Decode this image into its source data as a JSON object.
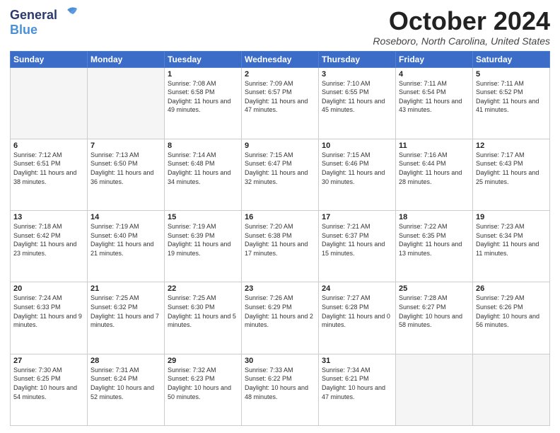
{
  "header": {
    "logo_line1": "General",
    "logo_line2": "Blue",
    "month_title": "October 2024",
    "location": "Roseboro, North Carolina, United States"
  },
  "days_of_week": [
    "Sunday",
    "Monday",
    "Tuesday",
    "Wednesday",
    "Thursday",
    "Friday",
    "Saturday"
  ],
  "weeks": [
    [
      {
        "day": "",
        "sunrise": "",
        "sunset": "",
        "daylight": "",
        "empty": true
      },
      {
        "day": "",
        "sunrise": "",
        "sunset": "",
        "daylight": "",
        "empty": true
      },
      {
        "day": "1",
        "sunrise": "Sunrise: 7:08 AM",
        "sunset": "Sunset: 6:58 PM",
        "daylight": "Daylight: 11 hours and 49 minutes.",
        "empty": false
      },
      {
        "day": "2",
        "sunrise": "Sunrise: 7:09 AM",
        "sunset": "Sunset: 6:57 PM",
        "daylight": "Daylight: 11 hours and 47 minutes.",
        "empty": false
      },
      {
        "day": "3",
        "sunrise": "Sunrise: 7:10 AM",
        "sunset": "Sunset: 6:55 PM",
        "daylight": "Daylight: 11 hours and 45 minutes.",
        "empty": false
      },
      {
        "day": "4",
        "sunrise": "Sunrise: 7:11 AM",
        "sunset": "Sunset: 6:54 PM",
        "daylight": "Daylight: 11 hours and 43 minutes.",
        "empty": false
      },
      {
        "day": "5",
        "sunrise": "Sunrise: 7:11 AM",
        "sunset": "Sunset: 6:52 PM",
        "daylight": "Daylight: 11 hours and 41 minutes.",
        "empty": false
      }
    ],
    [
      {
        "day": "6",
        "sunrise": "Sunrise: 7:12 AM",
        "sunset": "Sunset: 6:51 PM",
        "daylight": "Daylight: 11 hours and 38 minutes.",
        "empty": false
      },
      {
        "day": "7",
        "sunrise": "Sunrise: 7:13 AM",
        "sunset": "Sunset: 6:50 PM",
        "daylight": "Daylight: 11 hours and 36 minutes.",
        "empty": false
      },
      {
        "day": "8",
        "sunrise": "Sunrise: 7:14 AM",
        "sunset": "Sunset: 6:48 PM",
        "daylight": "Daylight: 11 hours and 34 minutes.",
        "empty": false
      },
      {
        "day": "9",
        "sunrise": "Sunrise: 7:15 AM",
        "sunset": "Sunset: 6:47 PM",
        "daylight": "Daylight: 11 hours and 32 minutes.",
        "empty": false
      },
      {
        "day": "10",
        "sunrise": "Sunrise: 7:15 AM",
        "sunset": "Sunset: 6:46 PM",
        "daylight": "Daylight: 11 hours and 30 minutes.",
        "empty": false
      },
      {
        "day": "11",
        "sunrise": "Sunrise: 7:16 AM",
        "sunset": "Sunset: 6:44 PM",
        "daylight": "Daylight: 11 hours and 28 minutes.",
        "empty": false
      },
      {
        "day": "12",
        "sunrise": "Sunrise: 7:17 AM",
        "sunset": "Sunset: 6:43 PM",
        "daylight": "Daylight: 11 hours and 25 minutes.",
        "empty": false
      }
    ],
    [
      {
        "day": "13",
        "sunrise": "Sunrise: 7:18 AM",
        "sunset": "Sunset: 6:42 PM",
        "daylight": "Daylight: 11 hours and 23 minutes.",
        "empty": false
      },
      {
        "day": "14",
        "sunrise": "Sunrise: 7:19 AM",
        "sunset": "Sunset: 6:40 PM",
        "daylight": "Daylight: 11 hours and 21 minutes.",
        "empty": false
      },
      {
        "day": "15",
        "sunrise": "Sunrise: 7:19 AM",
        "sunset": "Sunset: 6:39 PM",
        "daylight": "Daylight: 11 hours and 19 minutes.",
        "empty": false
      },
      {
        "day": "16",
        "sunrise": "Sunrise: 7:20 AM",
        "sunset": "Sunset: 6:38 PM",
        "daylight": "Daylight: 11 hours and 17 minutes.",
        "empty": false
      },
      {
        "day": "17",
        "sunrise": "Sunrise: 7:21 AM",
        "sunset": "Sunset: 6:37 PM",
        "daylight": "Daylight: 11 hours and 15 minutes.",
        "empty": false
      },
      {
        "day": "18",
        "sunrise": "Sunrise: 7:22 AM",
        "sunset": "Sunset: 6:35 PM",
        "daylight": "Daylight: 11 hours and 13 minutes.",
        "empty": false
      },
      {
        "day": "19",
        "sunrise": "Sunrise: 7:23 AM",
        "sunset": "Sunset: 6:34 PM",
        "daylight": "Daylight: 11 hours and 11 minutes.",
        "empty": false
      }
    ],
    [
      {
        "day": "20",
        "sunrise": "Sunrise: 7:24 AM",
        "sunset": "Sunset: 6:33 PM",
        "daylight": "Daylight: 11 hours and 9 minutes.",
        "empty": false
      },
      {
        "day": "21",
        "sunrise": "Sunrise: 7:25 AM",
        "sunset": "Sunset: 6:32 PM",
        "daylight": "Daylight: 11 hours and 7 minutes.",
        "empty": false
      },
      {
        "day": "22",
        "sunrise": "Sunrise: 7:25 AM",
        "sunset": "Sunset: 6:30 PM",
        "daylight": "Daylight: 11 hours and 5 minutes.",
        "empty": false
      },
      {
        "day": "23",
        "sunrise": "Sunrise: 7:26 AM",
        "sunset": "Sunset: 6:29 PM",
        "daylight": "Daylight: 11 hours and 2 minutes.",
        "empty": false
      },
      {
        "day": "24",
        "sunrise": "Sunrise: 7:27 AM",
        "sunset": "Sunset: 6:28 PM",
        "daylight": "Daylight: 11 hours and 0 minutes.",
        "empty": false
      },
      {
        "day": "25",
        "sunrise": "Sunrise: 7:28 AM",
        "sunset": "Sunset: 6:27 PM",
        "daylight": "Daylight: 10 hours and 58 minutes.",
        "empty": false
      },
      {
        "day": "26",
        "sunrise": "Sunrise: 7:29 AM",
        "sunset": "Sunset: 6:26 PM",
        "daylight": "Daylight: 10 hours and 56 minutes.",
        "empty": false
      }
    ],
    [
      {
        "day": "27",
        "sunrise": "Sunrise: 7:30 AM",
        "sunset": "Sunset: 6:25 PM",
        "daylight": "Daylight: 10 hours and 54 minutes.",
        "empty": false
      },
      {
        "day": "28",
        "sunrise": "Sunrise: 7:31 AM",
        "sunset": "Sunset: 6:24 PM",
        "daylight": "Daylight: 10 hours and 52 minutes.",
        "empty": false
      },
      {
        "day": "29",
        "sunrise": "Sunrise: 7:32 AM",
        "sunset": "Sunset: 6:23 PM",
        "daylight": "Daylight: 10 hours and 50 minutes.",
        "empty": false
      },
      {
        "day": "30",
        "sunrise": "Sunrise: 7:33 AM",
        "sunset": "Sunset: 6:22 PM",
        "daylight": "Daylight: 10 hours and 48 minutes.",
        "empty": false
      },
      {
        "day": "31",
        "sunrise": "Sunrise: 7:34 AM",
        "sunset": "Sunset: 6:21 PM",
        "daylight": "Daylight: 10 hours and 47 minutes.",
        "empty": false
      },
      {
        "day": "",
        "sunrise": "",
        "sunset": "",
        "daylight": "",
        "empty": true
      },
      {
        "day": "",
        "sunrise": "",
        "sunset": "",
        "daylight": "",
        "empty": true
      }
    ]
  ]
}
